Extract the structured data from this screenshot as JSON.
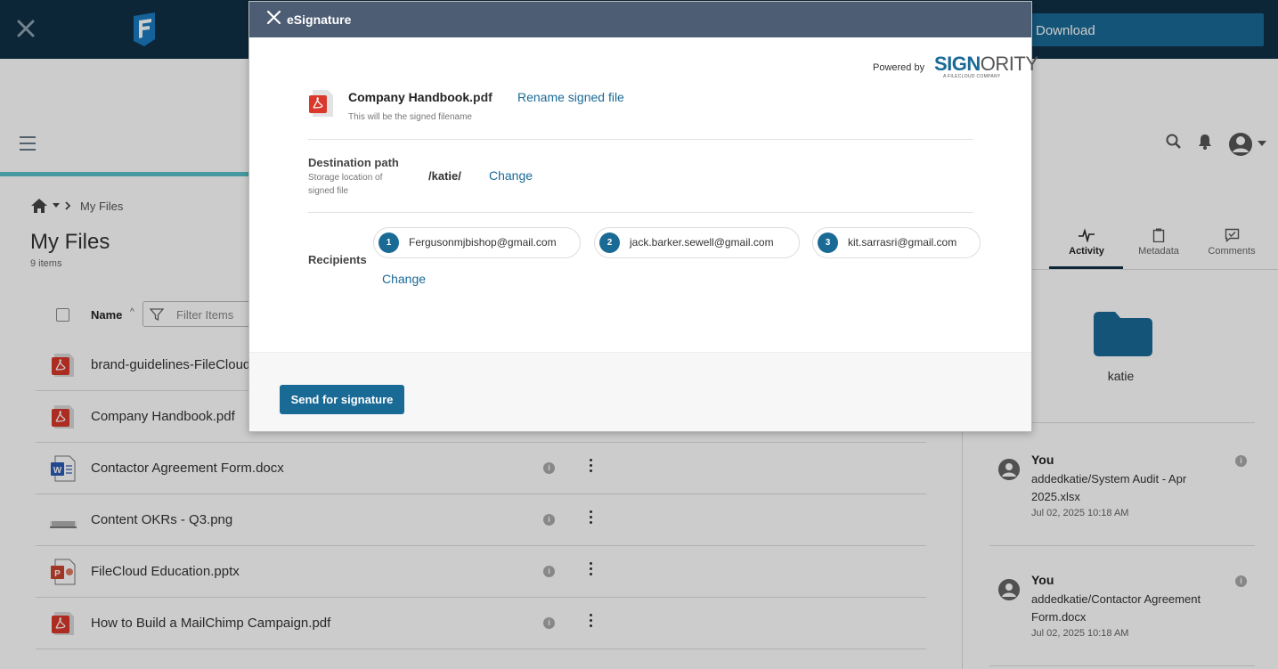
{
  "topbar": {
    "download_label": "Download"
  },
  "breadcrumb": {
    "current": "My Files"
  },
  "page": {
    "title": "My Files",
    "item_count": "9 items"
  },
  "list": {
    "column_name": "Name",
    "filter_placeholder": "Filter Items",
    "files": [
      {
        "name": "brand-guidelines-FileCloud",
        "icon": "pdf-icon"
      },
      {
        "name": "Company Handbook.pdf",
        "icon": "pdf-icon"
      },
      {
        "name": "Contactor Agreement Form.docx",
        "icon": "word-icon"
      },
      {
        "name": "Content OKRs - Q3.png",
        "icon": "image-icon"
      },
      {
        "name": "FileCloud Education.pptx",
        "icon": "powerpoint-icon"
      },
      {
        "name": "How to Build a MailChimp Campaign.pdf",
        "icon": "pdf-icon"
      }
    ]
  },
  "right_panel": {
    "tabs": [
      {
        "label": "Activity",
        "icon": "activity-icon",
        "active": true
      },
      {
        "label": "Metadata",
        "icon": "clipboard-icon",
        "active": false
      },
      {
        "label": "Comments",
        "icon": "comment-check-icon",
        "active": false
      }
    ],
    "folder_name": "katie",
    "activities": [
      {
        "who": "You",
        "what": "addedkatie/System Audit - Apr 2025.xlsx",
        "when": "Jul 02, 2025 10:18 AM"
      },
      {
        "who": "You",
        "what": "addedkatie/Contactor Agreement Form.docx",
        "when": "Jul 02, 2025 10:18 AM"
      }
    ]
  },
  "modal": {
    "title": "eSignature",
    "powered_by": "Powered by",
    "brand_part1": "SIGN",
    "brand_part2": "ORITY",
    "brand_sub": "A FILECLOUD COMPANY",
    "file_base": "Company Handbook",
    "file_ext": ".pdf",
    "rename_label": "Rename signed file",
    "file_hint": "This will be the signed filename",
    "destination_label": "Destination path",
    "destination_hint": "Storage location of signed file",
    "destination_value": "/katie/",
    "destination_change": "Change",
    "recipients_label": "Recipients",
    "recipients": [
      {
        "num": "1",
        "email": "Fergusonmjbishop@gmail.com"
      },
      {
        "num": "2",
        "email": "jack.barker.sewell@gmail.com"
      },
      {
        "num": "3",
        "email": "kit.sarrasri@gmail.com"
      }
    ],
    "recipients_change": "Change",
    "send_label": "Send for signature"
  },
  "colors": {
    "topbar": "#0f3047",
    "accent": "#1a6a96",
    "modal_header": "#4d5d73",
    "pdf_red": "#d9382b",
    "word_blue": "#2b5bb5",
    "ppt_red": "#c8452e"
  }
}
